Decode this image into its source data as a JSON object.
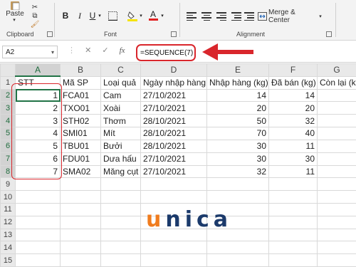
{
  "ribbon": {
    "paste_label": "Paste",
    "clipboard_label": "Clipboard",
    "font_label": "Font",
    "alignment_label": "Alignment",
    "merge_label": "Merge & Center",
    "bold": "B",
    "italic": "I",
    "underline": "U",
    "font_color_glyph": "A"
  },
  "formula_bar": {
    "name_box": "A2",
    "formula": "=SEQUENCE(7)",
    "fx": "fx"
  },
  "columns": [
    "A",
    "B",
    "C",
    "D",
    "E",
    "F",
    "G"
  ],
  "rows": [
    [
      "STT",
      "Mã SP",
      "Loại quả",
      "Ngày nhập hàng",
      "Nhập hàng (kg)",
      "Đã bán (kg)",
      "Còn lại (k"
    ],
    [
      "1",
      "FCA01",
      "Cam",
      "27/10/2021",
      "14",
      "14",
      ""
    ],
    [
      "2",
      "TXO01",
      "Xoài",
      "27/10/2021",
      "20",
      "20",
      ""
    ],
    [
      "3",
      "STH02",
      "Thơm",
      "28/10/2021",
      "50",
      "32",
      ""
    ],
    [
      "4",
      "SMI01",
      "Mít",
      "28/10/2021",
      "70",
      "40",
      ""
    ],
    [
      "5",
      "TBU01",
      "Bưởi",
      "28/10/2021",
      "30",
      "11",
      ""
    ],
    [
      "6",
      "FDU01",
      "Dưa hấu",
      "27/10/2021",
      "30",
      "30",
      ""
    ],
    [
      "7",
      "SMA02",
      "Măng cụt",
      "27/10/2021",
      "32",
      "11",
      ""
    ]
  ],
  "row_numbers": [
    "1",
    "2",
    "3",
    "4",
    "5",
    "6",
    "7",
    "8",
    "9",
    "10",
    "11",
    "12",
    "13",
    "14",
    "15"
  ],
  "watermark": {
    "u": "u",
    "rest": "nica"
  },
  "colors": {
    "accent_green": "#217346",
    "highlight_red": "#d9262c",
    "logo_orange": "#f07c1e",
    "logo_navy": "#1b3a6b"
  }
}
